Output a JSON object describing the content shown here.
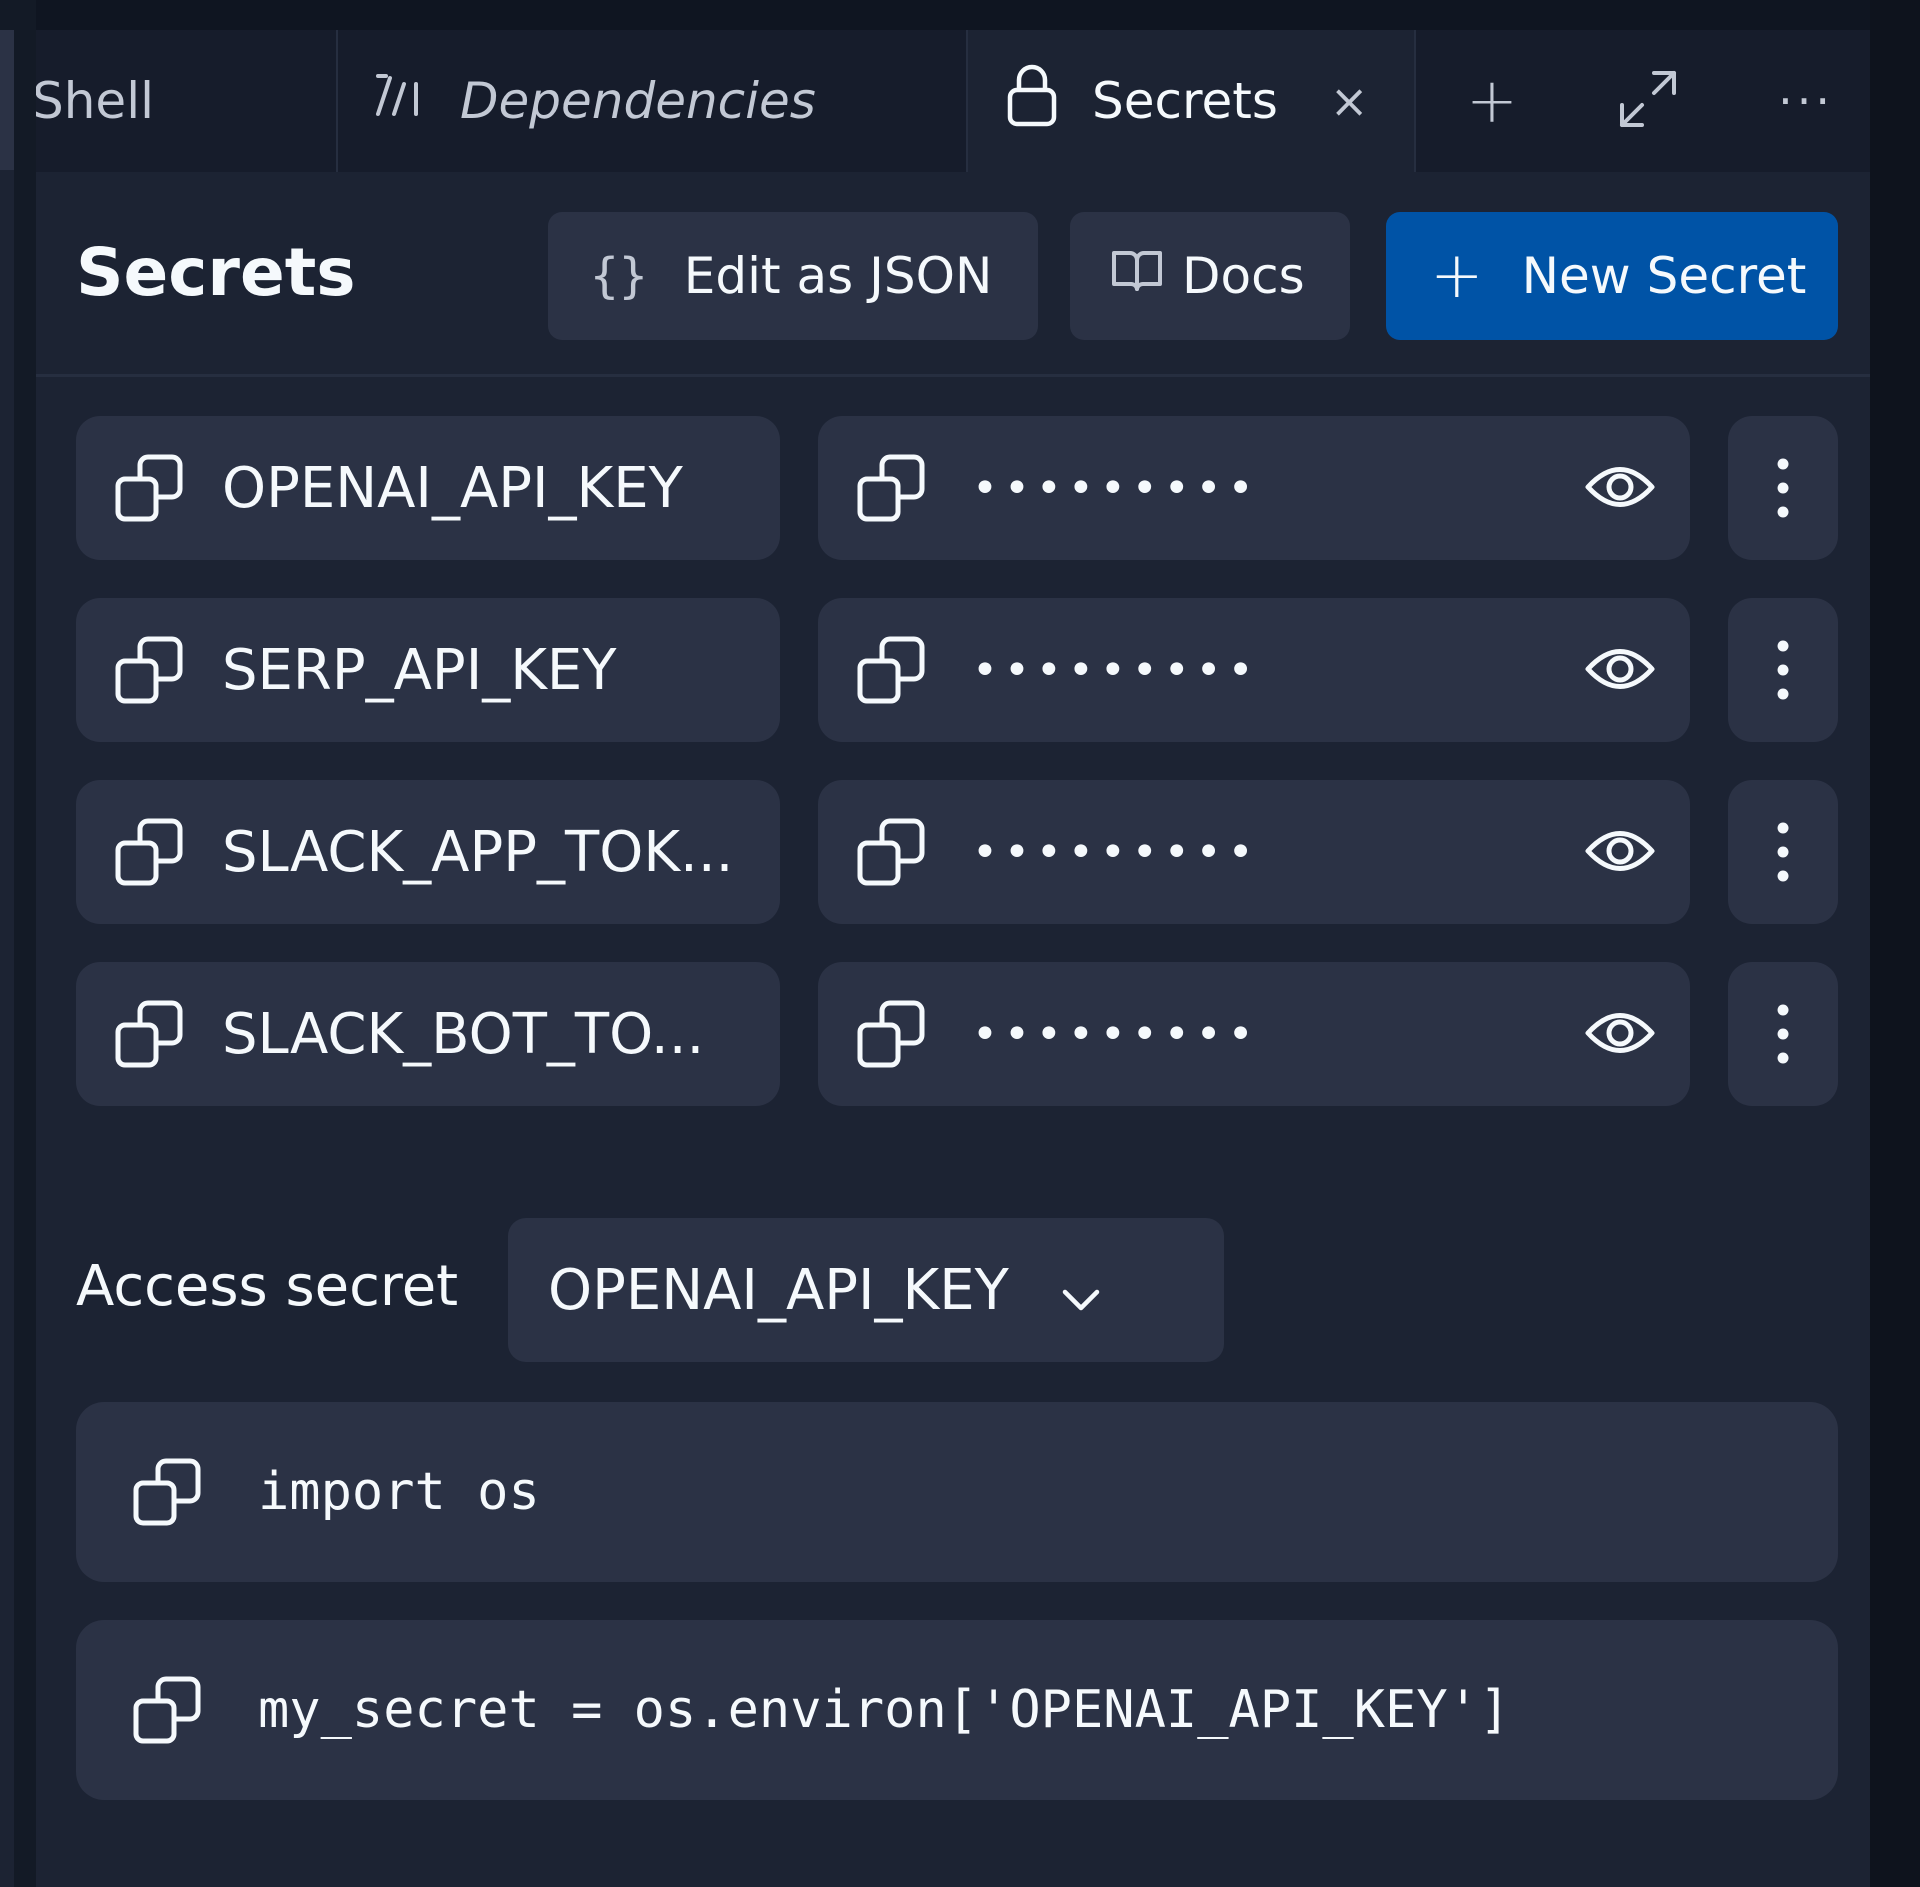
{
  "tabs": [
    {
      "label": "Shell",
      "icon": "terminal-icon",
      "active": false
    },
    {
      "label": "Dependencies",
      "icon": "package-icon",
      "active": false
    },
    {
      "label": "Secrets",
      "icon": "lock-icon",
      "active": true,
      "close": "×"
    }
  ],
  "tabbar_actions": {
    "add": "+",
    "more": "···"
  },
  "header": {
    "title": "Secrets",
    "edit_json_icon": "{}",
    "edit_json_label": "Edit as JSON",
    "docs_label": "Docs",
    "new_secret_icon": "+",
    "new_secret_label": "New Secret"
  },
  "secrets": [
    {
      "key": "OPENAI_API_KEY",
      "value": "•••••••••"
    },
    {
      "key": "SERP_API_KEY",
      "value": "•••••••••"
    },
    {
      "key": "SLACK_APP_TOK...",
      "value": "•••••••••"
    },
    {
      "key": "SLACK_BOT_TO...",
      "value": "•••••••••"
    }
  ],
  "access": {
    "label": "Access secret",
    "selected": "OPENAI_API_KEY"
  },
  "code": {
    "line1": "import os",
    "line2": "my_secret = os.environ['OPENAI_API_KEY']"
  },
  "colors": {
    "panel": "#1c2333",
    "surface": "#2b3245",
    "accent": "#0053a6",
    "text": "#f5f9fc",
    "muted": "#c2c8d4"
  }
}
